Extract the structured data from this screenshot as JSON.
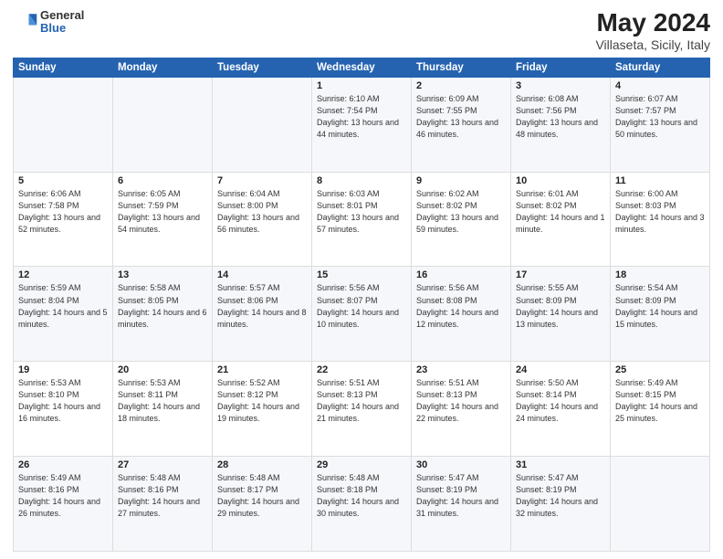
{
  "logo": {
    "general": "General",
    "blue": "Blue"
  },
  "header": {
    "month": "May 2024",
    "location": "Villaseta, Sicily, Italy"
  },
  "weekdays": [
    "Sunday",
    "Monday",
    "Tuesday",
    "Wednesday",
    "Thursday",
    "Friday",
    "Saturday"
  ],
  "weeks": [
    [
      {
        "day": "",
        "sunrise": "",
        "sunset": "",
        "daylight": ""
      },
      {
        "day": "",
        "sunrise": "",
        "sunset": "",
        "daylight": ""
      },
      {
        "day": "",
        "sunrise": "",
        "sunset": "",
        "daylight": ""
      },
      {
        "day": "1",
        "sunrise": "6:10 AM",
        "sunset": "7:54 PM",
        "daylight": "13 hours and 44 minutes."
      },
      {
        "day": "2",
        "sunrise": "6:09 AM",
        "sunset": "7:55 PM",
        "daylight": "13 hours and 46 minutes."
      },
      {
        "day": "3",
        "sunrise": "6:08 AM",
        "sunset": "7:56 PM",
        "daylight": "13 hours and 48 minutes."
      },
      {
        "day": "4",
        "sunrise": "6:07 AM",
        "sunset": "7:57 PM",
        "daylight": "13 hours and 50 minutes."
      }
    ],
    [
      {
        "day": "5",
        "sunrise": "6:06 AM",
        "sunset": "7:58 PM",
        "daylight": "13 hours and 52 minutes."
      },
      {
        "day": "6",
        "sunrise": "6:05 AM",
        "sunset": "7:59 PM",
        "daylight": "13 hours and 54 minutes."
      },
      {
        "day": "7",
        "sunrise": "6:04 AM",
        "sunset": "8:00 PM",
        "daylight": "13 hours and 56 minutes."
      },
      {
        "day": "8",
        "sunrise": "6:03 AM",
        "sunset": "8:01 PM",
        "daylight": "13 hours and 57 minutes."
      },
      {
        "day": "9",
        "sunrise": "6:02 AM",
        "sunset": "8:02 PM",
        "daylight": "13 hours and 59 minutes."
      },
      {
        "day": "10",
        "sunrise": "6:01 AM",
        "sunset": "8:02 PM",
        "daylight": "14 hours and 1 minute."
      },
      {
        "day": "11",
        "sunrise": "6:00 AM",
        "sunset": "8:03 PM",
        "daylight": "14 hours and 3 minutes."
      }
    ],
    [
      {
        "day": "12",
        "sunrise": "5:59 AM",
        "sunset": "8:04 PM",
        "daylight": "14 hours and 5 minutes."
      },
      {
        "day": "13",
        "sunrise": "5:58 AM",
        "sunset": "8:05 PM",
        "daylight": "14 hours and 6 minutes."
      },
      {
        "day": "14",
        "sunrise": "5:57 AM",
        "sunset": "8:06 PM",
        "daylight": "14 hours and 8 minutes."
      },
      {
        "day": "15",
        "sunrise": "5:56 AM",
        "sunset": "8:07 PM",
        "daylight": "14 hours and 10 minutes."
      },
      {
        "day": "16",
        "sunrise": "5:56 AM",
        "sunset": "8:08 PM",
        "daylight": "14 hours and 12 minutes."
      },
      {
        "day": "17",
        "sunrise": "5:55 AM",
        "sunset": "8:09 PM",
        "daylight": "14 hours and 13 minutes."
      },
      {
        "day": "18",
        "sunrise": "5:54 AM",
        "sunset": "8:09 PM",
        "daylight": "14 hours and 15 minutes."
      }
    ],
    [
      {
        "day": "19",
        "sunrise": "5:53 AM",
        "sunset": "8:10 PM",
        "daylight": "14 hours and 16 minutes."
      },
      {
        "day": "20",
        "sunrise": "5:53 AM",
        "sunset": "8:11 PM",
        "daylight": "14 hours and 18 minutes."
      },
      {
        "day": "21",
        "sunrise": "5:52 AM",
        "sunset": "8:12 PM",
        "daylight": "14 hours and 19 minutes."
      },
      {
        "day": "22",
        "sunrise": "5:51 AM",
        "sunset": "8:13 PM",
        "daylight": "14 hours and 21 minutes."
      },
      {
        "day": "23",
        "sunrise": "5:51 AM",
        "sunset": "8:13 PM",
        "daylight": "14 hours and 22 minutes."
      },
      {
        "day": "24",
        "sunrise": "5:50 AM",
        "sunset": "8:14 PM",
        "daylight": "14 hours and 24 minutes."
      },
      {
        "day": "25",
        "sunrise": "5:49 AM",
        "sunset": "8:15 PM",
        "daylight": "14 hours and 25 minutes."
      }
    ],
    [
      {
        "day": "26",
        "sunrise": "5:49 AM",
        "sunset": "8:16 PM",
        "daylight": "14 hours and 26 minutes."
      },
      {
        "day": "27",
        "sunrise": "5:48 AM",
        "sunset": "8:16 PM",
        "daylight": "14 hours and 27 minutes."
      },
      {
        "day": "28",
        "sunrise": "5:48 AM",
        "sunset": "8:17 PM",
        "daylight": "14 hours and 29 minutes."
      },
      {
        "day": "29",
        "sunrise": "5:48 AM",
        "sunset": "8:18 PM",
        "daylight": "14 hours and 30 minutes."
      },
      {
        "day": "30",
        "sunrise": "5:47 AM",
        "sunset": "8:19 PM",
        "daylight": "14 hours and 31 minutes."
      },
      {
        "day": "31",
        "sunrise": "5:47 AM",
        "sunset": "8:19 PM",
        "daylight": "14 hours and 32 minutes."
      },
      {
        "day": "",
        "sunrise": "",
        "sunset": "",
        "daylight": ""
      }
    ]
  ]
}
